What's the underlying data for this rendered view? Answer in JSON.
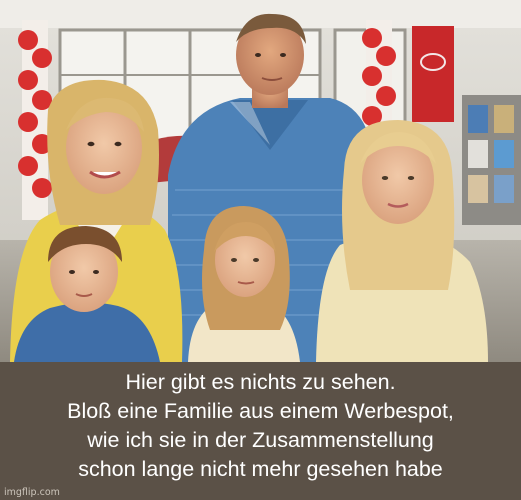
{
  "caption": {
    "lines": [
      "Hier gibt es nichts zu sehen.",
      "Bloß eine Familie aus einem Werbespot,",
      "wie ich sie in der Zusammenstellung",
      "schon lange nicht mehr gesehen habe"
    ]
  },
  "watermark": "imgflip.com",
  "colors": {
    "caption_band": "#5b5147",
    "caption_text": "#ffffff",
    "showroom_wall": "#dcdad3",
    "shirt_blue": "#4d82b8"
  }
}
